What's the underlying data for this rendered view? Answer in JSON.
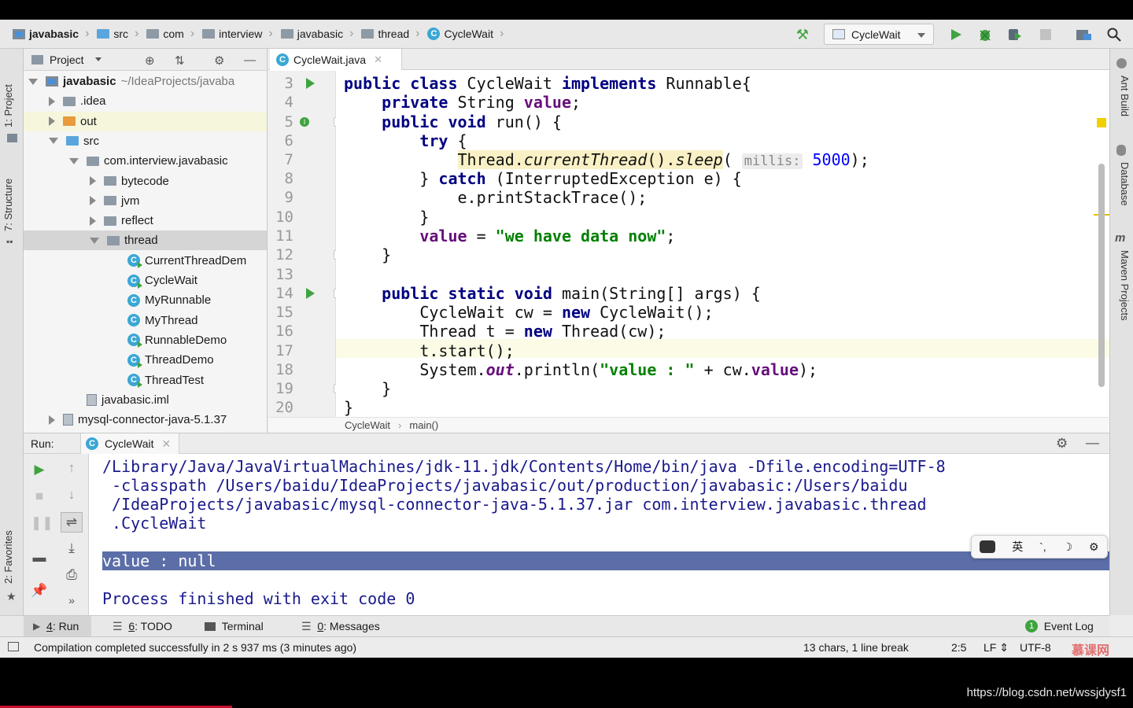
{
  "breadcrumbs": [
    "javabasic",
    "src",
    "com",
    "interview",
    "javabasic",
    "thread",
    "CycleWait"
  ],
  "run_config": {
    "selected": "CycleWait"
  },
  "left_tool_tabs": [
    "1: Project",
    "7: Structure",
    "2: Favorites"
  ],
  "right_tool_tabs": [
    "Ant Build",
    "Database",
    "Maven Projects"
  ],
  "project_panel": {
    "title": "Project",
    "tree": [
      {
        "label": "javabasic",
        "extra": "~/IdeaProjects/javaba",
        "depth": 0,
        "state": "open",
        "icon": "project-icon"
      },
      {
        "label": ".idea",
        "depth": 1,
        "state": "closed",
        "icon": "folder-icon"
      },
      {
        "label": "out",
        "depth": 1,
        "state": "closed",
        "icon": "folder-orange-icon"
      },
      {
        "label": "src",
        "depth": 1,
        "state": "open",
        "icon": "folder-blue-icon"
      },
      {
        "label": "com.interview.javabasic",
        "depth": 2,
        "state": "open",
        "icon": "package-icon"
      },
      {
        "label": "bytecode",
        "depth": 3,
        "state": "closed",
        "icon": "package-icon"
      },
      {
        "label": "jvm",
        "depth": 3,
        "state": "closed",
        "icon": "package-icon"
      },
      {
        "label": "reflect",
        "depth": 3,
        "state": "closed",
        "icon": "package-icon"
      },
      {
        "label": "thread",
        "depth": 3,
        "state": "open",
        "icon": "package-icon"
      },
      {
        "label": "CurrentThreadDem",
        "depth": 4,
        "state": "leaf",
        "icon": "class-run-icon"
      },
      {
        "label": "CycleWait",
        "depth": 4,
        "state": "leaf",
        "icon": "class-run-icon"
      },
      {
        "label": "MyRunnable",
        "depth": 4,
        "state": "leaf",
        "icon": "class-icon"
      },
      {
        "label": "MyThread",
        "depth": 4,
        "state": "leaf",
        "icon": "class-icon"
      },
      {
        "label": "RunnableDemo",
        "depth": 4,
        "state": "leaf",
        "icon": "class-run-icon"
      },
      {
        "label": "ThreadDemo",
        "depth": 4,
        "state": "leaf",
        "icon": "class-run-icon"
      },
      {
        "label": "ThreadTest",
        "depth": 4,
        "state": "leaf",
        "icon": "class-run-icon"
      },
      {
        "label": "javabasic.iml",
        "depth": 2,
        "state": "leaf",
        "icon": "iml-icon"
      },
      {
        "label": "mysql-connector-java-5.1.37",
        "depth": 1,
        "state": "closed",
        "icon": "jar-icon"
      }
    ]
  },
  "editor": {
    "tab": "CycleWait.java",
    "line_numbers": [
      "3",
      "4",
      "5",
      "6",
      "7",
      "8",
      "9",
      "10",
      "11",
      "12",
      "13",
      "14",
      "15",
      "16",
      "17",
      "18",
      "19",
      "20"
    ],
    "breadcrumb": [
      "CycleWait",
      "main()"
    ],
    "code": {
      "l3": {
        "kw1": "public class ",
        "t1": "CycleWait ",
        "kw2": "implements ",
        "t2": "Runnable{"
      },
      "l4": {
        "kw1": "    private ",
        "t1": "String ",
        "fld": "value",
        "t2": ";"
      },
      "l5": {
        "kw1": "    public void ",
        "t1": "run() {"
      },
      "l6": {
        "kw1": "        try ",
        "t1": "{"
      },
      "l7": {
        "t1": "            ",
        "call1": "Thread.",
        "call2": "currentThread",
        "call3": "().",
        "call4": "sleep",
        "t2": "( ",
        "hint": "millis:",
        "num": "5000",
        "t3": ");"
      },
      "l8": {
        "t1": "        } ",
        "kw1": "catch ",
        "t2": "(InterruptedException e) {"
      },
      "l9": {
        "t1": "            e.printStackTrace();"
      },
      "l10": {
        "t1": "        }"
      },
      "l11": {
        "t1": "        ",
        "fld": "value",
        "t2": " = ",
        "str": "\"we have data now\"",
        "t3": ";"
      },
      "l12": {
        "t1": "    }"
      },
      "l13": {
        "t1": ""
      },
      "l14": {
        "kw1": "    public static void ",
        "t1": "main(String[] args) {"
      },
      "l15": {
        "t1": "        CycleWait cw = ",
        "kw1": "new ",
        "t2": "CycleWait();"
      },
      "l16": {
        "t1": "        Thread t = ",
        "kw1": "new ",
        "t2": "Thread(cw);"
      },
      "l17": {
        "t1": "        t.start();"
      },
      "l18": {
        "t1": "        System.",
        "out": "out",
        "t2": ".println(",
        "str": "\"value : \"",
        "t3": " + cw.",
        "fld": "value",
        "t4": ");"
      },
      "l19": {
        "t1": "    }"
      },
      "l20": {
        "t1": "}"
      }
    }
  },
  "run_panel": {
    "label": "Run:",
    "tab": "CycleWait",
    "console": [
      "/Library/Java/JavaVirtualMachines/jdk-11.jdk/Contents/Home/bin/java -Dfile.encoding=UTF-8",
      " -classpath /Users/baidu/IdeaProjects/javabasic/out/production/javabasic:/Users/baidu",
      " /IdeaProjects/javabasic/mysql-connector-java-5.1.37.jar com.interview.javabasic.thread",
      " .CycleWait",
      "value : null",
      "",
      "Process finished with exit code 0"
    ]
  },
  "ime": {
    "lang": "英",
    "punct": "`,"
  },
  "toolwindows": [
    {
      "num": "4",
      "label": ": Run"
    },
    {
      "num": "6",
      "label": ": TODO"
    },
    {
      "num": "",
      "label": "Terminal"
    },
    {
      "num": "0",
      "label": ": Messages"
    }
  ],
  "event_log": {
    "count": "1",
    "label": "Event Log"
  },
  "status": {
    "message": "Compilation completed successfully in 2 s 937 ms (3 minutes ago)",
    "selection": "13 chars, 1 line break",
    "position": "2:5",
    "line_sep": "LF",
    "encoding": "UTF-8"
  },
  "watermarks": {
    "logo": "慕课网",
    "url": "https://blog.csdn.net/wssjdysf1"
  },
  "colors": {
    "keyword": "#000080",
    "field": "#660e7a",
    "string": "#008000",
    "number": "#0000ff",
    "console_text": "#1a1a8c",
    "selection": "#5b6ea8",
    "run_green": "#3fa33f"
  }
}
